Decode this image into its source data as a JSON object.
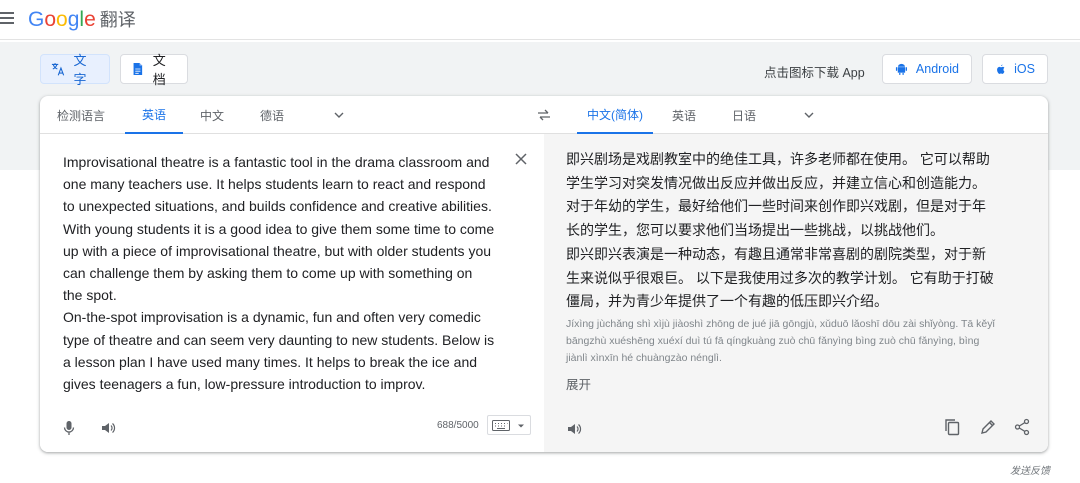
{
  "header": {
    "brand_letters": [
      "G",
      "o",
      "o",
      "g",
      "l",
      "e"
    ],
    "product": "翻译",
    "menu_icon": "hamburger-menu-icon"
  },
  "mode_tabs": [
    {
      "label": "文字",
      "icon": "translate-icon",
      "active": true
    },
    {
      "label": "文档",
      "icon": "document-icon",
      "active": false
    }
  ],
  "app_promo": {
    "text": "点击图标下载 App",
    "android_label": "Android",
    "ios_label": "iOS"
  },
  "source_languages": {
    "tabs": [
      {
        "label": "检测语言",
        "active": false
      },
      {
        "label": "英语",
        "active": true
      },
      {
        "label": "中文",
        "active": false
      },
      {
        "label": "德语",
        "active": false
      }
    ]
  },
  "target_languages": {
    "tabs": [
      {
        "label": "中文(简体)",
        "active": true
      },
      {
        "label": "英语",
        "active": false
      },
      {
        "label": "日语",
        "active": false
      }
    ]
  },
  "source": {
    "paragraphs": [
      [
        "Improvisational theatre is a fantastic tool in the drama classroom and",
        "one many teachers use. It helps students learn to react and respond",
        "to unexpected situations, and builds confidence and creative abilities.",
        "With young students it is a good idea to give them some time to come",
        "up with a piece of improvisational theatre, but with older students you",
        "can challenge them by asking them to come up with something on",
        "the spot."
      ],
      [
        "On-the-spot improvisation is a dynamic, fun and often very comedic",
        "type of theatre and can seem very daunting to new students. Below is",
        "a lesson plan I have used many times. It helps to break the ice and",
        "gives teenagers a fun, low-pressure introduction to improv."
      ]
    ],
    "char_count": "688/5000"
  },
  "target": {
    "lines": [
      "即兴剧场是戏剧教室中的绝佳工具，许多老师都在使用。 它可以帮助",
      "学生学习对突发情况做出反应并做出反应，并建立信心和创造能力。",
      "对于年幼的学生，最好给他们一些时间来创作即兴戏剧，但是对于年",
      "长的学生，您可以要求他们当场提出一些挑战，以挑战他们。",
      "即兴即兴表演是一种动态，有趣且通常非常喜剧的剧院类型，对于新",
      "生来说似乎很艰巨。 以下是我使用过多次的教学计划。 它有助于打破",
      "僵局，并为青少年提供了一个有趣的低压即兴介绍。"
    ],
    "romanization": [
      "Jíxìng jùchǎng shì xìjù jiàoshì zhōng de jué jiā gōngjù, xǔduō lǎoshī dōu zài shǐyòng. Tā kěyǐ",
      "bāngzhù xuéshēng xuéxí duì tú fā qíngkuàng zuò chū fǎnyìng bìng zuò chū fǎnyìng, bìng",
      "jiànlì xìnxīn hé chuàngzào nénglì."
    ],
    "expand_label": "展开"
  },
  "footer": {
    "feedback": "发送反馈"
  },
  "colors": {
    "accent": "#1a73e8",
    "band": "#f1f3f4",
    "target_bg": "#f5f5f5"
  }
}
